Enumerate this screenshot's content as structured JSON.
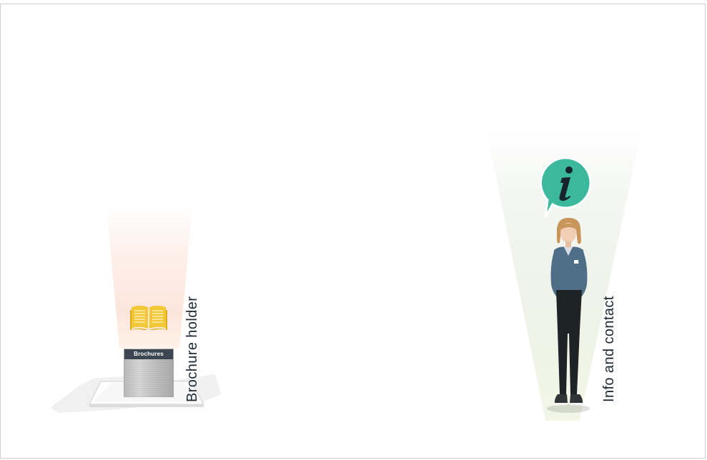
{
  "scene": {
    "brochure_holder": {
      "vertical_label": "Brochure holder",
      "stand_label": "Brochures",
      "book_icon": "open-book-icon",
      "accent_color": "#f3c836"
    },
    "info_contact": {
      "vertical_label": "Info and contact",
      "bubble_icon": "info-bubble-icon",
      "bubble_color": "#3cb89d"
    }
  }
}
